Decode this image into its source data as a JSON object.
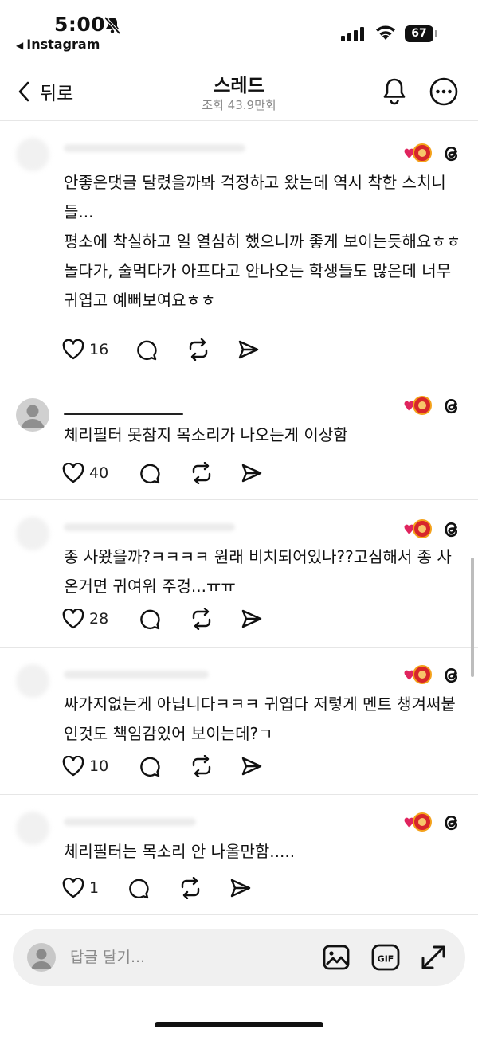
{
  "status_bar": {
    "time": "5:00",
    "back_app": "Instagram",
    "battery": "67"
  },
  "header": {
    "back_label": "뒤로",
    "title": "스레드",
    "subtitle": "조회 43.9만회"
  },
  "comments": [
    {
      "lines": [
        "안좋은댓글 달렸을까봐 걱정하고 왔는데 역시 착한 스치니들...",
        "평소에 착실하고 일 열심히 했으니까 좋게 보이는듯해요ㅎㅎ",
        "놀다가, 술먹다가 아프다고 안나오는 학생들도 많은데 너무 귀엽고 예뻐보여요ㅎㅎ"
      ],
      "likes": "16"
    },
    {
      "lines": [
        "체리필터 못참지 목소리가 나오는게 이상함"
      ],
      "likes": "40"
    },
    {
      "lines": [
        "종 사왔을까?ㅋㅋㅋㅋ 원래 비치되어있나??고심해서 종 사온거면 귀여워 주겅...ㅠㅠ"
      ],
      "likes": "28"
    },
    {
      "lines": [
        "싸가지없는게 아닙니다ㅋㅋㅋ 귀엽다 저렇게 멘트 챙겨써붙인것도 책임감있어 보이는데?ㄱ"
      ],
      "likes": "10"
    },
    {
      "lines": [
        "체리필터는 목소리 안 나올만함....."
      ],
      "likes": "1"
    }
  ],
  "composer": {
    "placeholder": "답글 달기..."
  }
}
